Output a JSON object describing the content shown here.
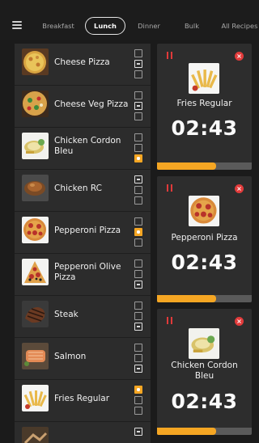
{
  "tabs": [
    {
      "label": "Breakfast",
      "active": false
    },
    {
      "label": "Lunch",
      "active": true
    },
    {
      "label": "Dinner",
      "active": false
    },
    {
      "label": "Bulk",
      "active": false
    },
    {
      "label": "All Recipes",
      "active": false
    }
  ],
  "list": {
    "items": [
      {
        "name": "Cheese Pizza",
        "image": "cheese-pizza",
        "checks": [
          "empty",
          "minus",
          "empty"
        ]
      },
      {
        "name": "Cheese Veg Pizza",
        "image": "cheese-veg-pizza",
        "checks": [
          "empty",
          "minus",
          "empty"
        ]
      },
      {
        "name": "Chicken Cordon Bleu",
        "image": "chicken-cordon-bleu",
        "checks": [
          "empty",
          "empty",
          "dot"
        ]
      },
      {
        "name": "Chicken RC",
        "image": "chicken-rc",
        "checks": [
          "minus",
          "empty",
          "empty"
        ]
      },
      {
        "name": "Pepperoni Pizza",
        "image": "pepperoni-pizza",
        "checks": [
          "empty",
          "dot",
          "empty"
        ]
      },
      {
        "name": "Pepperoni Olive Pizza",
        "image": "pepperoni-olive-pizza",
        "checks": [
          "empty",
          "empty",
          "minus"
        ]
      },
      {
        "name": "Steak",
        "image": "steak",
        "checks": [
          "empty",
          "empty",
          "minus"
        ]
      },
      {
        "name": "Salmon",
        "image": "salmon",
        "checks": [
          "empty",
          "empty",
          "minus"
        ]
      },
      {
        "name": "Fries Regular",
        "image": "fries",
        "checks": [
          "dot",
          "empty",
          "empty"
        ]
      },
      {
        "name": "",
        "image": "partial-item",
        "checks": [
          "minus"
        ]
      }
    ]
  },
  "timers": [
    {
      "name": "Fries Regular",
      "time": "02:43",
      "image": "fries",
      "progress": 0.62
    },
    {
      "name": "Pepperoni Pizza",
      "time": "02:43",
      "image": "pepperoni-pizza",
      "progress": 0.62
    },
    {
      "name": "Chicken Cordon Bleu",
      "time": "02:43",
      "image": "chicken-cordon-bleu",
      "progress": 0.62
    }
  ],
  "colors": {
    "accent": "#f5a623",
    "danger": "#e23b3b",
    "panel": "#2c2c2c",
    "background": "#1b1b1b"
  }
}
